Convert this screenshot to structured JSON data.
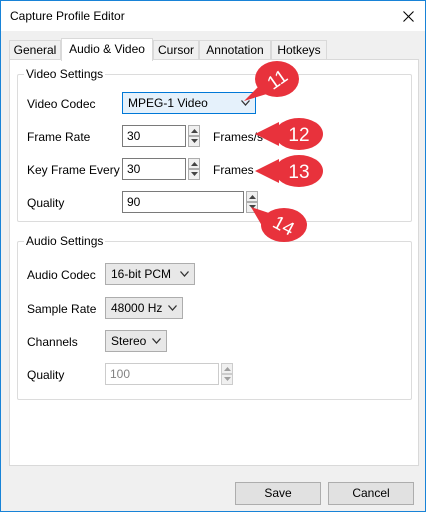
{
  "window": {
    "title": "Capture Profile Editor"
  },
  "tabs": [
    {
      "label": "General"
    },
    {
      "label": "Audio & Video"
    },
    {
      "label": "Cursor"
    },
    {
      "label": "Annotation"
    },
    {
      "label": "Hotkeys"
    }
  ],
  "video": {
    "group_title": "Video Settings",
    "codec_label": "Video Codec",
    "codec_value": "MPEG-1 Video",
    "frame_rate_label": "Frame Rate",
    "frame_rate_value": "30",
    "frame_rate_unit": "Frames/s",
    "key_frame_label": "Key Frame Every",
    "key_frame_value": "30",
    "key_frame_unit": "Frames",
    "quality_label": "Quality",
    "quality_value": "90"
  },
  "audio": {
    "group_title": "Audio Settings",
    "codec_label": "Audio Codec",
    "codec_value": "16-bit PCM",
    "sample_rate_label": "Sample Rate",
    "sample_rate_value": "48000 Hz",
    "channels_label": "Channels",
    "channels_value": "Stereo",
    "quality_label": "Quality",
    "quality_value": "100"
  },
  "callouts": [
    {
      "number": "11"
    },
    {
      "number": "12"
    },
    {
      "number": "13"
    },
    {
      "number": "14"
    }
  ],
  "buttons": {
    "save": "Save",
    "cancel": "Cancel"
  },
  "colors": {
    "callout": "#e8323c",
    "accent": "#0078d7"
  }
}
